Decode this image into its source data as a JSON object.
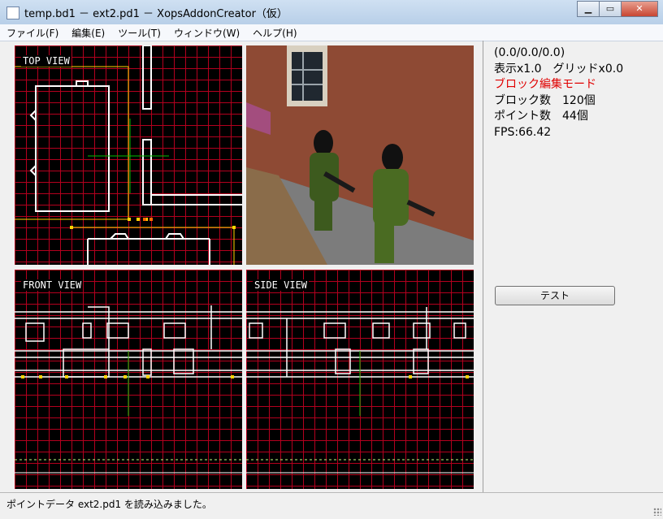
{
  "window": {
    "title": "temp.bd1 － ext2.pd1 － XopsAddonCreator（仮）",
    "minimize_glyph": "▁",
    "maximize_glyph": "▭",
    "close_glyph": "✕"
  },
  "menu": {
    "items": [
      "ファイル(F)",
      "編集(E)",
      "ツール(T)",
      "ウィンドウ(W)",
      "ヘルプ(H)"
    ]
  },
  "views": {
    "top_label": "TOP VIEW",
    "front_label": "FRONT VIEW",
    "side_label": "SIDE VIEW"
  },
  "info": {
    "coords": "(0.0/0.0/0.0)",
    "display": "表示x1.0　グリッドx0.0",
    "mode": "ブロック編集モード",
    "block_count": "ブロック数　120個",
    "point_count": "ポイント数　44個",
    "fps": "FPS:66.42"
  },
  "buttons": {
    "test_label": "テスト"
  },
  "status": {
    "message": "ポイントデータ ext2.pd1 を読み込みました。"
  },
  "colors": {
    "grid": "#b3001e",
    "wire": "#ffffff",
    "point": "#ffd400",
    "mode_text": "#e00000"
  }
}
